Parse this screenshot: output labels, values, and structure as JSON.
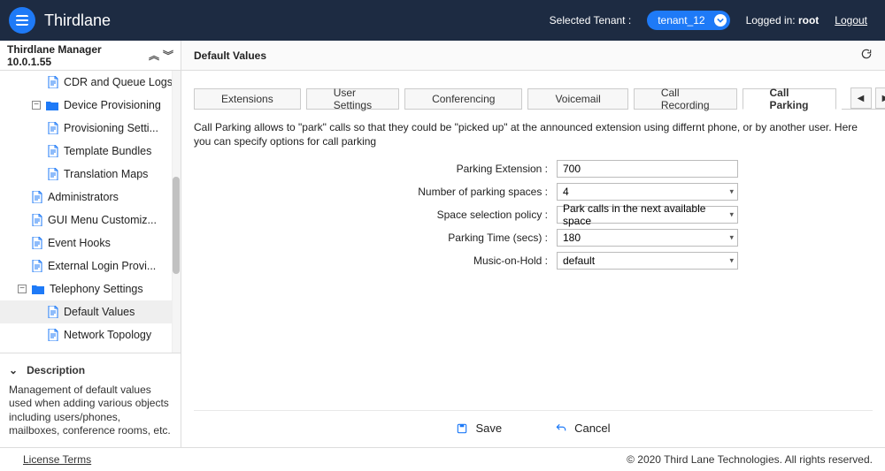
{
  "header": {
    "brand": "Thirdlane",
    "selected_tenant_label": "Selected Tenant :",
    "tenant_name": "tenant_12",
    "logged_in_prefix": "Logged in: ",
    "logged_in_user": "root",
    "logout": "Logout"
  },
  "sidebar": {
    "title": "Thirdlane Manager 10.0.1.55",
    "items": [
      {
        "label": "CDR and Queue Logs",
        "type": "page",
        "level": 1
      },
      {
        "label": "Device Provisioning",
        "type": "folder",
        "level": 0,
        "expandable": true
      },
      {
        "label": "Provisioning Setti...",
        "type": "page",
        "level": 1
      },
      {
        "label": "Template Bundles",
        "type": "page",
        "level": 1
      },
      {
        "label": "Translation Maps",
        "type": "page",
        "level": 1
      },
      {
        "label": "Administrators",
        "type": "page",
        "level": 0
      },
      {
        "label": "GUI Menu Customiz...",
        "type": "page",
        "level": 0
      },
      {
        "label": "Event Hooks",
        "type": "page",
        "level": 0
      },
      {
        "label": "External Login Provi...",
        "type": "page",
        "level": 0
      },
      {
        "label": "Telephony Settings",
        "type": "folder",
        "level": -1,
        "expandable": true
      },
      {
        "label": "Default Values",
        "type": "page",
        "level": 1,
        "selected": true
      },
      {
        "label": "Network Topology",
        "type": "page",
        "level": 1
      }
    ],
    "description_title": "Description",
    "description_body": "Management of default values used when adding various objects including users/phones, mailboxes, conference rooms, etc."
  },
  "main": {
    "title": "Default Values",
    "tabs": [
      "Extensions",
      "User Settings",
      "Conferencing",
      "Voicemail",
      "Call Recording",
      "Call Parking"
    ],
    "active_tab_index": 5,
    "description": "Call Parking allows to \"park\" calls so that they could be \"picked up\" at the announced extension using differnt phone, or by another user. Here you can specify options for call parking",
    "form": {
      "parking_extension_label": "Parking Extension :",
      "parking_extension_value": "700",
      "num_spaces_label": "Number of parking spaces  :",
      "num_spaces_value": "4",
      "policy_label": "Space selection policy :",
      "policy_value": "Park calls in the next available space",
      "parking_time_label": "Parking Time (secs) :",
      "parking_time_value": "180",
      "moh_label": "Music-on-Hold :",
      "moh_value": "default"
    },
    "actions": {
      "save": "Save",
      "cancel": "Cancel"
    }
  },
  "footer": {
    "license": "License Terms",
    "copyright": "© 2020 Third Lane Technologies. All rights reserved."
  }
}
